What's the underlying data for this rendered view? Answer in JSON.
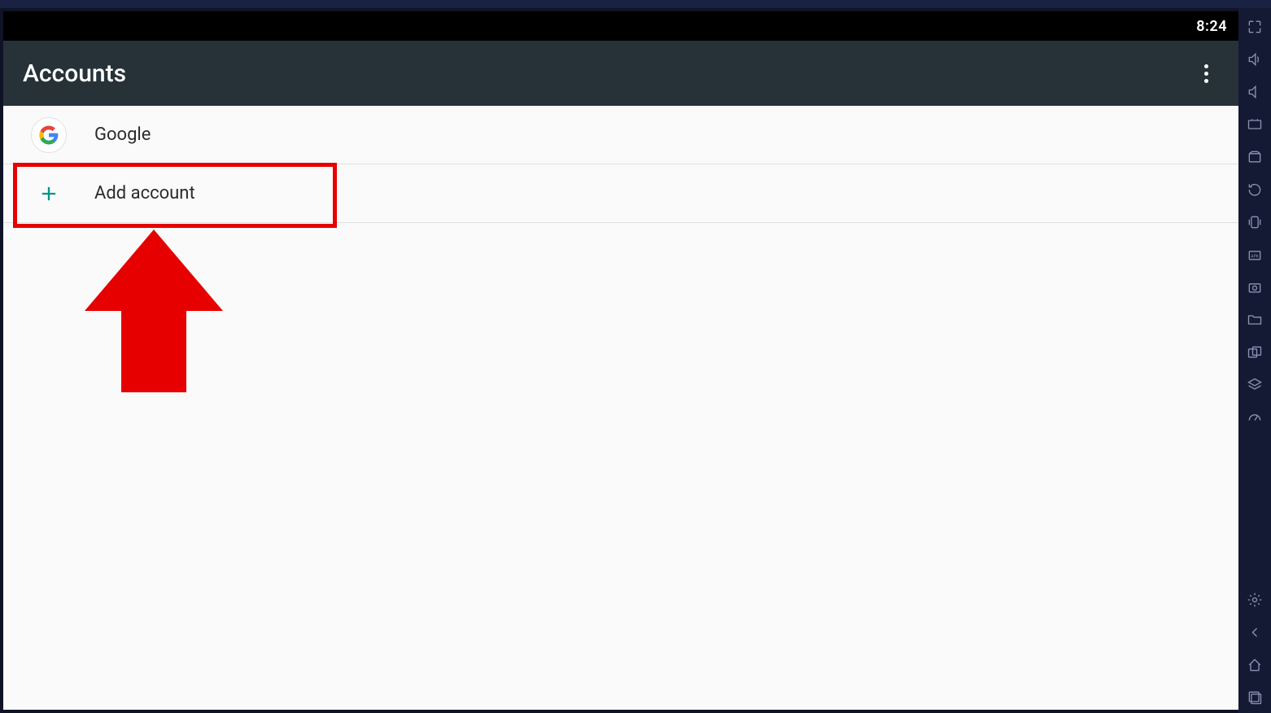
{
  "status_bar": {
    "clock": "8:24"
  },
  "app_bar": {
    "title": "Accounts"
  },
  "accounts_list": {
    "items": [
      {
        "label": "Google",
        "icon": "google-icon"
      }
    ],
    "add_label": "Add account"
  },
  "side_toolbar": {
    "icons": [
      "fullscreen-icon",
      "volume-up-icon",
      "volume-down-icon",
      "keymap-icon",
      "sync-apps-icon",
      "rotate-icon",
      "shake-icon",
      "apk-icon",
      "screenshot-icon",
      "media-folder-icon",
      "multi-instance-icon",
      "layers-icon",
      "speed-icon",
      "settings-icon",
      "back-icon",
      "home-icon",
      "recents-icon"
    ]
  }
}
